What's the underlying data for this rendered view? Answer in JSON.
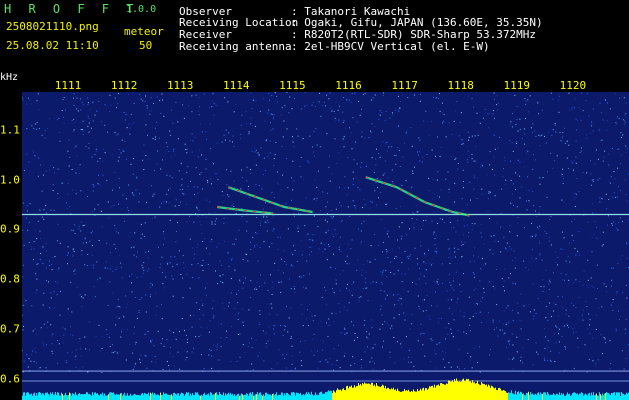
{
  "header": {
    "app_title": "H R O F F T",
    "version": "1.0.0",
    "filename": "2508021110.png",
    "datetime": "25.08.02 11:10",
    "meteor_label": "meteor",
    "meteor_count": "50",
    "info_labels": {
      "observer": "Observer",
      "location": "Receiving Location",
      "receiver": "Receiver",
      "antenna": "Receiving antenna"
    },
    "info_values": {
      "observer": ": Takanori Kawachi",
      "location": ": Ogaki, Gifu, JAPAN (136.60E, 35.35N)",
      "receiver": ": R820T2(RTL-SDR) SDR-Sharp 53.372MHz",
      "antenna": ": 2el-HB9CV Vertical (el. E-W)"
    }
  },
  "colors": {
    "background": "#0b1a6b",
    "axis_label": "#ffff00",
    "title": "#5fe05f",
    "echo_hot": "#ff3030",
    "echo_mid": "#30ff90",
    "carrier": "#a8ffff",
    "noise_floor": "#00e5ff",
    "noise_peak": "#ffff00"
  },
  "chart_data": {
    "type": "heatmap",
    "xlabel": "",
    "ylabel": "kHz",
    "x_ticks": [
      "1111",
      "1112",
      "1113",
      "1114",
      "1115",
      "1116",
      "1117",
      "1118",
      "1119",
      "1120"
    ],
    "y_ticks": [
      "1.1",
      "1.0",
      "0.9",
      "0.8",
      "0.7",
      "0.6"
    ],
    "x_range": [
      1110.6,
      1120.3
    ],
    "y_range": [
      0.58,
      1.16
    ],
    "carrier_freq_khz": 0.93,
    "echoes": [
      {
        "points": [
          [
            1116.45,
            1.005
          ],
          [
            1117.0,
            0.985
          ],
          [
            1117.5,
            0.955
          ],
          [
            1118.0,
            0.935
          ],
          [
            1118.3,
            0.928
          ]
        ]
      },
      {
        "points": [
          [
            1114.0,
            0.985
          ],
          [
            1114.5,
            0.965
          ],
          [
            1115.0,
            0.945
          ],
          [
            1115.5,
            0.935
          ]
        ]
      },
      {
        "points": [
          [
            1113.8,
            0.945
          ],
          [
            1114.3,
            0.938
          ],
          [
            1114.8,
            0.932
          ]
        ]
      }
    ]
  }
}
